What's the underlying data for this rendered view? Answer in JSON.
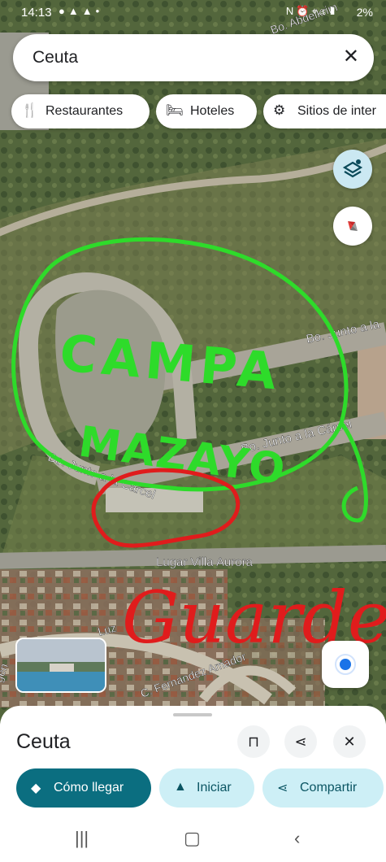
{
  "status_bar": {
    "time": "14:13",
    "left_icons": [
      "chat-icon",
      "a-icon",
      "a-icon",
      "dot-icon"
    ],
    "right_icons": [
      "nfc-icon",
      "alarm-icon",
      "location-icon",
      "wifi-icon",
      "signal-icon"
    ],
    "battery": "2%"
  },
  "search": {
    "value": "Ceuta"
  },
  "chips": [
    {
      "icon": "restaurant-icon",
      "label": "Restaurantes"
    },
    {
      "icon": "hotel-icon",
      "label": "Hoteles"
    },
    {
      "icon": "attractions-icon",
      "label": "Sitios de inter"
    }
  ],
  "map_labels": {
    "street_1": "Bo. Junto a la",
    "street_2": "Bo. Junto a la Cárcel",
    "street_3": "Bo. Junto a la Cárcel",
    "road_main": "Lugar Villa Aurora",
    "street_luz": "Luz",
    "street_fernandez": "C. Fernandez Amador",
    "street_gen": "gen",
    "street_top": "Bo. Abdelkrim"
  },
  "annotations": {
    "green_text": "CAMPA",
    "green_text_2": "MAZAYO",
    "red_text": "Guarde"
  },
  "colors": {
    "annotation_green": "#2edb2a",
    "annotation_red": "#e01c1c",
    "primary_button": "#0b6e80",
    "secondary_button": "#cdeff6",
    "location_dot": "#1a73e8"
  },
  "sheet": {
    "title": "Ceuta",
    "buttons": [
      {
        "icon": "navigate-icon",
        "label": "Cómo llegar"
      },
      {
        "icon": "start-arrow-icon",
        "label": "Iniciar"
      },
      {
        "icon": "share-icon",
        "label": "Compartir"
      }
    ]
  }
}
